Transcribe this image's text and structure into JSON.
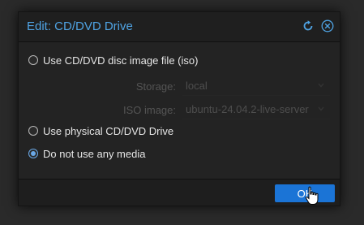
{
  "dialog": {
    "title": "Edit: CD/DVD Drive",
    "tools": {
      "reset_icon": "reset-icon",
      "close_icon": "close-icon"
    },
    "options": [
      {
        "label": "Use CD/DVD disc image file (iso)",
        "checked": false
      },
      {
        "label": "Use physical CD/DVD Drive",
        "checked": false
      },
      {
        "label": "Do not use any media",
        "checked": true
      }
    ],
    "storage": {
      "label": "Storage:",
      "value": "local"
    },
    "iso_image": {
      "label": "ISO image:",
      "value": "ubuntu-24.04.2-live-server"
    },
    "ok_label": "OK"
  },
  "colors": {
    "accent": "#4fa3e3",
    "button": "#1b74d6",
    "background": "#1c1c1c"
  }
}
